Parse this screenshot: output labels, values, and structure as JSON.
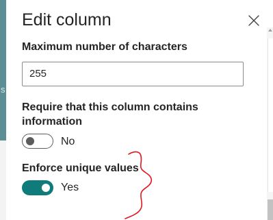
{
  "background": {
    "side_glyph": "s"
  },
  "panel": {
    "title": "Edit column",
    "close_icon": "close-icon"
  },
  "max_chars": {
    "label": "Maximum number of characters",
    "value": "255"
  },
  "require": {
    "label": "Require that this column contains information",
    "state_label": "No",
    "enabled": false
  },
  "unique": {
    "label": "Enforce unique values",
    "state_label": "Yes",
    "enabled": true
  },
  "colors": {
    "toggle_on": "#0f7b7b",
    "toggle_off_border": "#5c5c5c",
    "annotation": "#e4141b",
    "backdrop": "#5b8f95"
  }
}
